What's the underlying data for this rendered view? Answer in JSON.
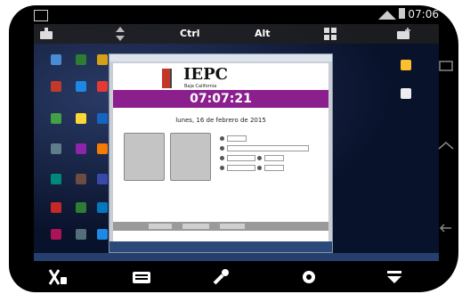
{
  "status": {
    "time": "07:06"
  },
  "topbar": {
    "ctrl": "Ctrl",
    "alt": "Alt"
  },
  "app": {
    "logo": "IEPC",
    "logo_sub": "Baja California",
    "clock": "07:07:21",
    "date": "lunes, 16 de febrero de 2015"
  },
  "colors": {
    "accent": "#8b1f8e",
    "logo_red": "#c0392b"
  },
  "icons": [
    "keyboard-icon",
    "windows-icon",
    "tools-icon",
    "settings-icon",
    "menu-down-icon",
    "mouse-off-icon"
  ]
}
